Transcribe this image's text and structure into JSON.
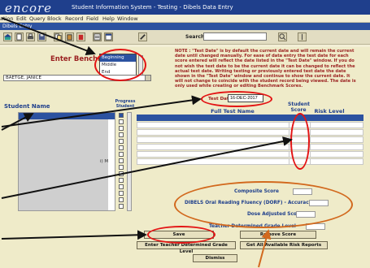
{
  "titlebar": {
    "logo": "encore",
    "title": "Student Information System - Testing - Dibels Data Entry"
  },
  "menubar": {
    "items": [
      "ation",
      "Edit",
      "Query",
      "Block",
      "Record",
      "Field",
      "Help",
      "Window"
    ]
  },
  "tabstrip": {
    "label": "Dibels Entry"
  },
  "toolbar": {
    "search_label": "Search:",
    "search_value": "",
    "icons": [
      "home-icon",
      "new-icon",
      "print-icon",
      "save-icon",
      "copy-icon",
      "paste-icon",
      "delete-icon",
      "list-icon",
      "window-icon",
      "tools-icon",
      "search-go-icon",
      "exit-icon"
    ]
  },
  "benchmark": {
    "title": "Enter Benchmark",
    "options": [
      "Beginning",
      "Middle",
      "End"
    ],
    "selected_index": 0
  },
  "student_combo": {
    "value": "BAETGE, JANICE"
  },
  "note": {
    "text": "NOTE : \"Test Date\" is by default the current date and will remain the current date until changed manually. For ease of data entry the test date for each score entered will reflect the date listed in the \"Test Date\" window. If you do not wish the test date to be the current date it can be changed to reflect the actual test date. Writing testing or previously entered test date the date shown in the \"Test Date\" window and continue to show the current date. It will not change to coincide with the student record being viewed. The date is only used while creating or editing Benchmark Scores."
  },
  "test_date": {
    "label": "Test Date:",
    "value": "16-DEC-2017"
  },
  "student_list": {
    "header": "Student Name",
    "progress_header": "Progress Student",
    "visible_fragment": "i) M",
    "rows": 15
  },
  "scores": {
    "full_test_header": "Full Test Name",
    "student_score_header": "Student Score",
    "risk_level_header": "Risk Level",
    "rows": 7
  },
  "summary": {
    "composite": "Composite Score",
    "dorf_accuracy": "DIBELS Oral Reading Fluency (DORF) - Accuracy %",
    "dose_adjusted": "Dose Adjusted Score",
    "teacher_grade_level": "Teacher Determined Grade Level"
  },
  "buttons": {
    "save": "Save",
    "remove_score": "Remove Score",
    "enter_teacher_grade": "Enter Teacher Determined Grade Level",
    "get_risk_reports": "Get All Available Risk Reports",
    "dismiss": "Dismiss"
  },
  "colors": {
    "annotation_red": "#e31414",
    "annotation_orange": "#d2691e",
    "header_blue": "#1f3f8c",
    "highlight_blue": "#2c52a0",
    "note_red": "#9a1f1f",
    "panel_bg": "#efebc9"
  }
}
